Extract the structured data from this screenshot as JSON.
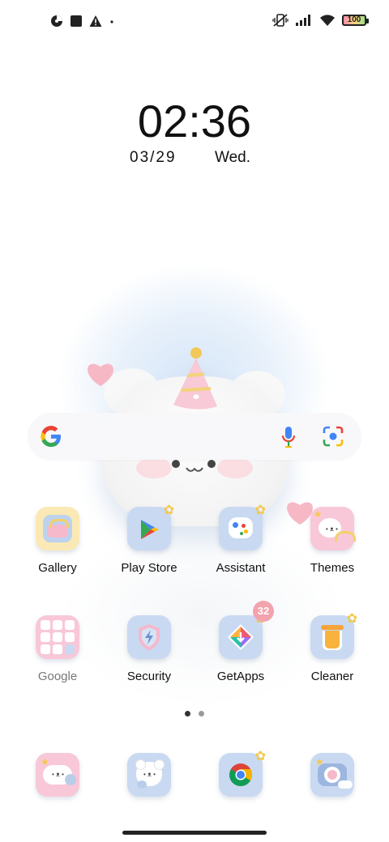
{
  "status_bar": {
    "left_icons": [
      "pie-chart-icon",
      "square-notification-icon",
      "warning-icon",
      "dot-icon"
    ],
    "right_icons": [
      "vibrate-off-icon",
      "signal-icon",
      "wifi-icon"
    ],
    "battery": "100"
  },
  "clock": {
    "time": "02:36",
    "date": "03/29",
    "day": "Wed."
  },
  "search": {
    "logo": "google-g-icon",
    "mic": "mic-icon",
    "lens": "lens-icon"
  },
  "apps_row1": [
    {
      "label": "Gallery"
    },
    {
      "label": "Play Store"
    },
    {
      "label": "Assistant"
    },
    {
      "label": "Themes"
    }
  ],
  "apps_row2": [
    {
      "label": "Google"
    },
    {
      "label": "Security"
    },
    {
      "label": "GetApps"
    },
    {
      "label": "Cleaner"
    }
  ],
  "getapps_badge": "32",
  "dock": [
    {
      "icon": "messages-icon"
    },
    {
      "icon": "contacts-icon"
    },
    {
      "icon": "chrome-icon"
    },
    {
      "icon": "camera-icon"
    }
  ],
  "page_indicator": {
    "pages": 2,
    "current": 1
  },
  "colors": {
    "accent_pink": "#f2a3ad",
    "icon_blue": "#c7d7f0",
    "icon_pink": "#f8c8d8",
    "text": "#111111"
  }
}
